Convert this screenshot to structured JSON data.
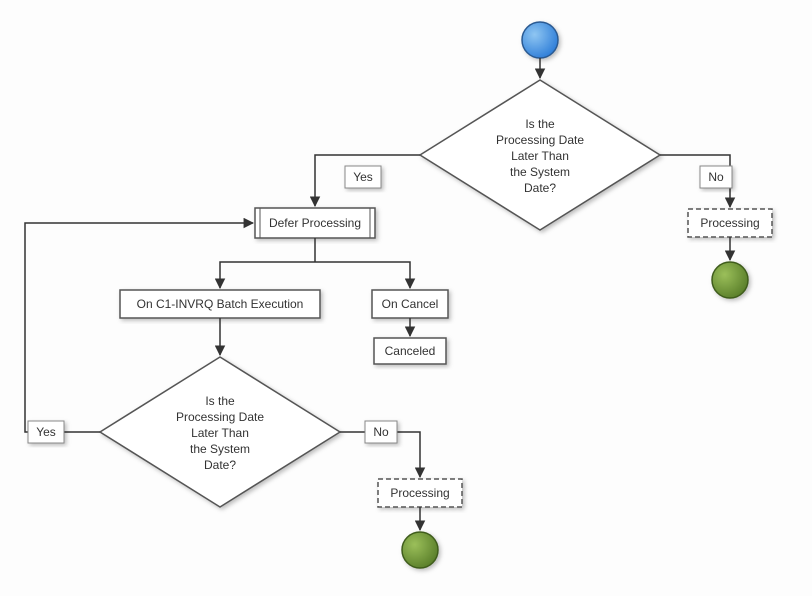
{
  "decision1": {
    "line1": "Is the",
    "line2": "Processing Date",
    "line3": "Later Than",
    "line4": "the System",
    "line5": "Date?"
  },
  "decision2": {
    "line1": "Is the",
    "line2": "Processing Date",
    "line3": "Later Than",
    "line4": "the System",
    "line5": "Date?"
  },
  "labels": {
    "yes1": "Yes",
    "no1": "No",
    "yes2": "Yes",
    "no2": "No"
  },
  "boxes": {
    "defer": "Defer Processing",
    "batch": "On C1-INVRQ Batch Execution",
    "oncancel": "On Cancel",
    "canceled": "Canceled",
    "processing1": "Processing",
    "processing2": "Processing"
  }
}
